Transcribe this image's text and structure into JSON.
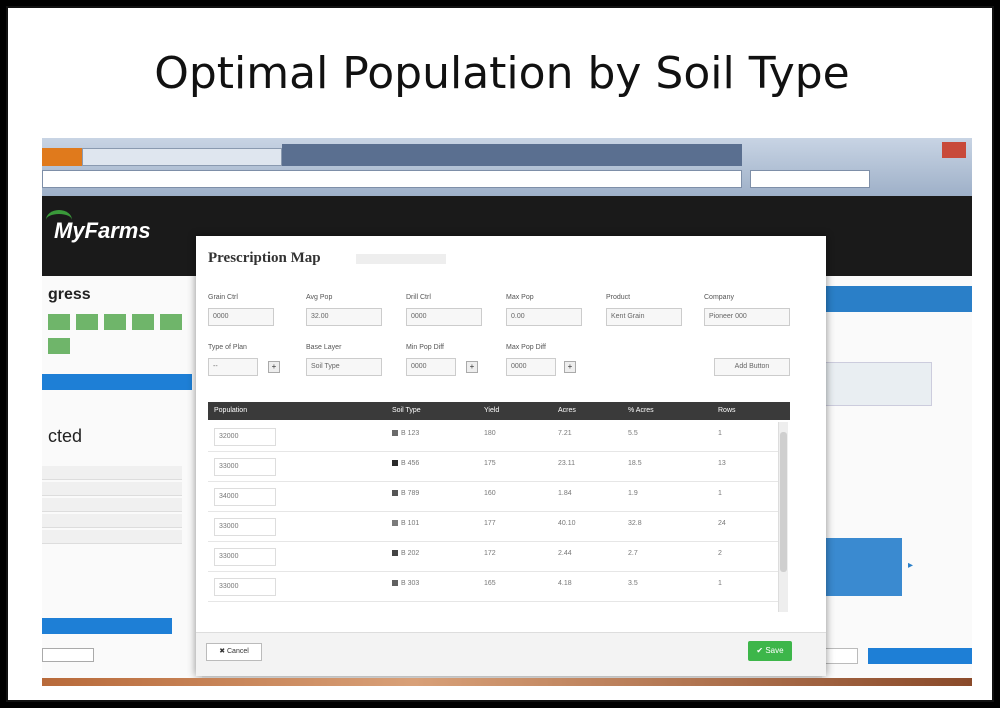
{
  "slide": {
    "title": "Optimal Population by Soil Type"
  },
  "app": {
    "logo": "MyFarms",
    "modal": {
      "title": "Prescription Map",
      "fields_row1": [
        {
          "label": "Grain Ctrl",
          "value": "0000"
        },
        {
          "label": "Avg Pop",
          "value": "32.00"
        },
        {
          "label": "Drill Ctrl",
          "value": "0000"
        },
        {
          "label": "Max Pop",
          "value": "0.00"
        },
        {
          "label": "Product",
          "value": "Kent Grain"
        },
        {
          "label": "Company",
          "value": "Pioneer 000"
        }
      ],
      "fields_row2": [
        {
          "label": "Type of Plan",
          "value": "--"
        },
        {
          "label": "Base Layer",
          "value": "Soil Type"
        },
        {
          "label": "Min Pop Diff",
          "value": "0000"
        },
        {
          "label": "Max Pop Diff",
          "value": "0000"
        }
      ],
      "add_button": "Add Button",
      "table": {
        "headers": [
          "Population",
          "Soil Type",
          "Yield",
          "Acres",
          "% Acres",
          "Rows"
        ],
        "rows": [
          {
            "population": "32000",
            "soil": "B 123",
            "yield": "180",
            "acres": "7.21",
            "pct": "5.5",
            "rows": "1",
            "color": "#6a6a6a"
          },
          {
            "population": "33000",
            "soil": "B 456",
            "yield": "175",
            "acres": "23.11",
            "pct": "18.5",
            "rows": "13",
            "color": "#2a2a2a"
          },
          {
            "population": "34000",
            "soil": "B 789",
            "yield": "160",
            "acres": "1.84",
            "pct": "1.9",
            "rows": "1",
            "color": "#555555"
          },
          {
            "population": "33000",
            "soil": "B 101",
            "yield": "177",
            "acres": "40.10",
            "pct": "32.8",
            "rows": "24",
            "color": "#7a7a7a"
          },
          {
            "population": "33000",
            "soil": "B 202",
            "yield": "172",
            "acres": "2.44",
            "pct": "2.7",
            "rows": "2",
            "color": "#444444"
          },
          {
            "population": "33000",
            "soil": "B 303",
            "yield": "165",
            "acres": "4.18",
            "pct": "3.5",
            "rows": "1",
            "color": "#606060"
          }
        ]
      },
      "cancel": "Cancel",
      "save": "Save"
    }
  }
}
